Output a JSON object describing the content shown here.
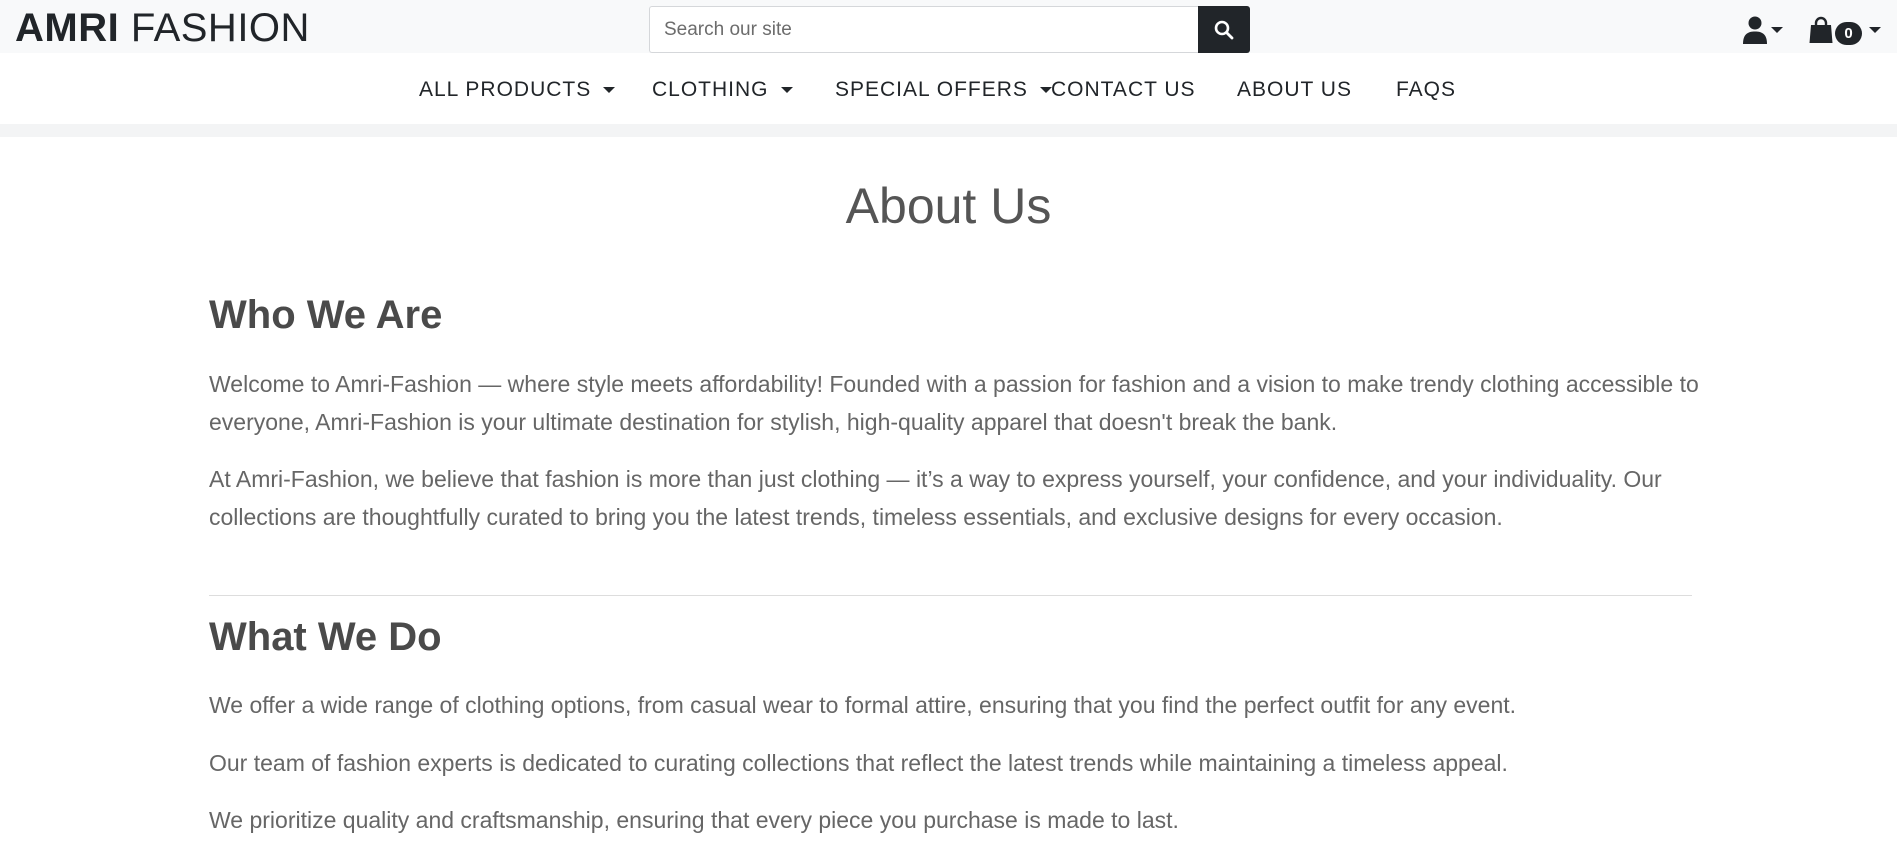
{
  "header": {
    "brand_bold": "AMRI",
    "brand_light": "FASHION",
    "search_placeholder": "Search our site",
    "cart_count": "0"
  },
  "nav": {
    "items": [
      {
        "label": "ALL PRODUCTS",
        "has_dropdown": true
      },
      {
        "label": "CLOTHING",
        "has_dropdown": true
      },
      {
        "label": "SPECIAL OFFERS",
        "has_dropdown": true
      },
      {
        "label": "CONTACT US",
        "has_dropdown": false
      },
      {
        "label": "ABOUT US",
        "has_dropdown": false
      },
      {
        "label": "FAQS",
        "has_dropdown": false
      }
    ]
  },
  "page": {
    "title": "About Us",
    "sections": [
      {
        "heading": "Who We Are",
        "paragraphs": [
          "Welcome to Amri-Fashion — where style meets affordability! Founded with a passion for fashion and a vision to make trendy clothing accessible to everyone, Amri-Fashion is your ultimate destination for stylish, high-quality apparel that doesn't break the bank.",
          "At Amri-Fashion, we believe that fashion is more than just clothing — it’s a way to express yourself, your confidence, and your individuality. Our collections are thoughtfully curated to bring you the latest trends, timeless essentials, and exclusive designs for every occasion."
        ]
      },
      {
        "heading": "What We Do",
        "paragraphs": [
          "We offer a wide range of clothing options, from casual wear to formal attire, ensuring that you find the perfect outfit for any event.",
          "Our team of fashion experts is dedicated to curating collections that reflect the latest trends while maintaining a timeless appeal.",
          "We prioritize quality and craftsmanship, ensuring that every piece you purchase is made to last."
        ]
      }
    ]
  },
  "icons": {
    "search": "search-icon",
    "account": "user-icon",
    "cart": "shopping-bag-icon",
    "dropdown": "caret-down-icon"
  },
  "colors": {
    "topbar_bg": "#f8f9fa",
    "dark": "#212529",
    "heading": "#4a4a4a",
    "body_text": "#666666"
  }
}
